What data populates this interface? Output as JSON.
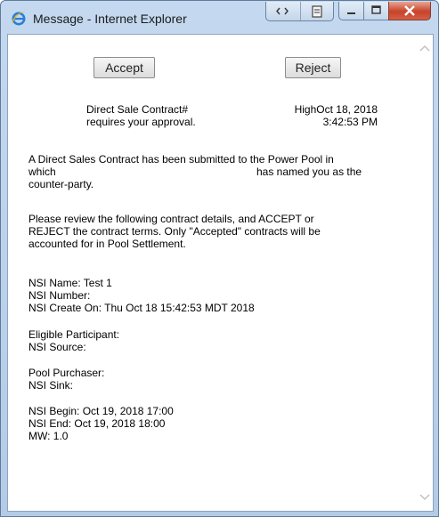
{
  "window": {
    "title": "Message - Internet Explorer",
    "accent": "#c4d9ef",
    "close_color": "#c8432a"
  },
  "actions": {
    "accept_label": "Accept",
    "reject_label": "Reject"
  },
  "header": {
    "contract_line1": "Direct Sale Contract#",
    "contract_line2": "requires your approval.",
    "date_line1": "HighOct 18, 2018",
    "date_line2": "3:42:53 PM"
  },
  "body": {
    "intro_line1": "A Direct Sales Contract has been submitted to the Power Pool in",
    "intro_line2a": "which",
    "intro_line2b": "has named you as the",
    "intro_line3": "counter-party.",
    "review_line1": "Please review the following contract details, and ACCEPT or",
    "review_line2": "REJECT the contract terms. Only \"Accepted\" contracts will be",
    "review_line3": "accounted for in Pool Settlement.",
    "nsi_name": "NSI Name: Test 1",
    "nsi_number": "NSI Number:",
    "nsi_create": "NSI Create On: Thu Oct 18 15:42:53 MDT 2018",
    "eligible_participant": "Eligible Participant:",
    "nsi_source": "NSI Source:",
    "pool_purchaser": "Pool Purchaser:",
    "nsi_sink": "NSI Sink:",
    "nsi_begin": "NSI Begin: Oct 19, 2018 17:00",
    "nsi_end": "NSI End: Oct 19, 2018 18:00",
    "mw": "MW: 1.0"
  }
}
